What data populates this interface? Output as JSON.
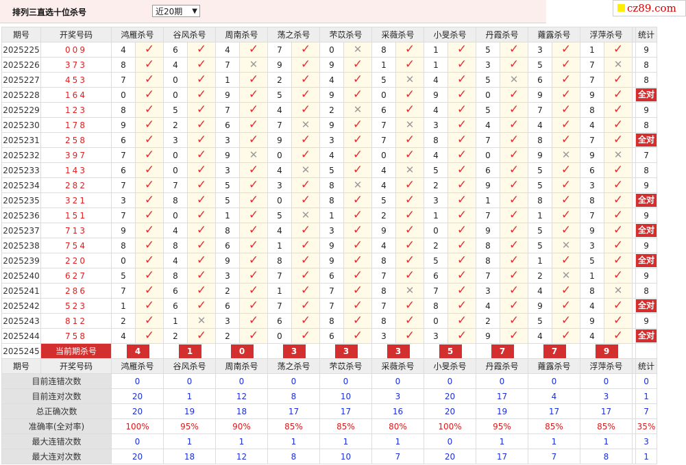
{
  "header": {
    "title": "排列三直选十位杀号",
    "period_select": "近20期"
  },
  "logo": {
    "text": "cz89.com"
  },
  "columns": {
    "period": "期号",
    "winning": "开奖号码",
    "total": "统计"
  },
  "experts": [
    "鸿雁杀号",
    "谷风杀号",
    "周南杀号",
    "荡之杀号",
    "芣苡杀号",
    "采薇杀号",
    "小旻杀号",
    "丹霞杀号",
    "蕹露杀号",
    "浮萍杀号"
  ],
  "rows": [
    {
      "period": "2025225",
      "win": "009",
      "k": [
        "4",
        "6",
        "4",
        "7",
        "0",
        "8",
        "1",
        "5",
        "3",
        "1"
      ],
      "r": [
        1,
        1,
        1,
        1,
        0,
        1,
        1,
        1,
        1,
        1
      ],
      "total": "9"
    },
    {
      "period": "2025226",
      "win": "373",
      "k": [
        "8",
        "4",
        "7",
        "9",
        "9",
        "1",
        "1",
        "3",
        "5",
        "7"
      ],
      "r": [
        1,
        1,
        0,
        1,
        1,
        1,
        1,
        1,
        1,
        0
      ],
      "total": "8"
    },
    {
      "period": "2025227",
      "win": "453",
      "k": [
        "7",
        "0",
        "1",
        "2",
        "4",
        "5",
        "4",
        "5",
        "6",
        "7"
      ],
      "r": [
        1,
        1,
        1,
        1,
        1,
        0,
        1,
        0,
        1,
        1
      ],
      "total": "8"
    },
    {
      "period": "2025228",
      "win": "164",
      "k": [
        "0",
        "0",
        "9",
        "5",
        "9",
        "0",
        "9",
        "0",
        "9",
        "9"
      ],
      "r": [
        1,
        1,
        1,
        1,
        1,
        1,
        1,
        1,
        1,
        1
      ],
      "total": "全对"
    },
    {
      "period": "2025229",
      "win": "123",
      "k": [
        "8",
        "5",
        "7",
        "4",
        "2",
        "6",
        "4",
        "5",
        "7",
        "8"
      ],
      "r": [
        1,
        1,
        1,
        1,
        0,
        1,
        1,
        1,
        1,
        1
      ],
      "total": "9"
    },
    {
      "period": "2025230",
      "win": "178",
      "k": [
        "9",
        "2",
        "6",
        "7",
        "9",
        "7",
        "3",
        "4",
        "4",
        "4"
      ],
      "r": [
        1,
        1,
        1,
        0,
        1,
        0,
        1,
        1,
        1,
        1
      ],
      "total": "8"
    },
    {
      "period": "2025231",
      "win": "258",
      "k": [
        "6",
        "3",
        "3",
        "9",
        "3",
        "7",
        "8",
        "7",
        "8",
        "7"
      ],
      "r": [
        1,
        1,
        1,
        1,
        1,
        1,
        1,
        1,
        1,
        1
      ],
      "total": "全对"
    },
    {
      "period": "2025232",
      "win": "397",
      "k": [
        "7",
        "0",
        "9",
        "0",
        "4",
        "0",
        "4",
        "0",
        "9",
        "9"
      ],
      "r": [
        1,
        1,
        0,
        1,
        1,
        1,
        1,
        1,
        0,
        0
      ],
      "total": "7"
    },
    {
      "period": "2025233",
      "win": "143",
      "k": [
        "6",
        "0",
        "3",
        "4",
        "5",
        "4",
        "5",
        "6",
        "5",
        "6"
      ],
      "r": [
        1,
        1,
        1,
        0,
        1,
        0,
        1,
        1,
        1,
        1
      ],
      "total": "8"
    },
    {
      "period": "2025234",
      "win": "282",
      "k": [
        "7",
        "7",
        "5",
        "3",
        "8",
        "4",
        "2",
        "9",
        "5",
        "3"
      ],
      "r": [
        1,
        1,
        1,
        1,
        0,
        1,
        1,
        1,
        1,
        1
      ],
      "total": "9"
    },
    {
      "period": "2025235",
      "win": "321",
      "k": [
        "3",
        "8",
        "5",
        "0",
        "8",
        "5",
        "3",
        "1",
        "8",
        "8"
      ],
      "r": [
        1,
        1,
        1,
        1,
        1,
        1,
        1,
        1,
        1,
        1
      ],
      "total": "全对"
    },
    {
      "period": "2025236",
      "win": "151",
      "k": [
        "7",
        "0",
        "1",
        "5",
        "1",
        "2",
        "1",
        "7",
        "1",
        "7"
      ],
      "r": [
        1,
        1,
        1,
        0,
        1,
        1,
        1,
        1,
        1,
        1
      ],
      "total": "9"
    },
    {
      "period": "2025237",
      "win": "713",
      "k": [
        "9",
        "4",
        "8",
        "4",
        "3",
        "9",
        "0",
        "9",
        "5",
        "9"
      ],
      "r": [
        1,
        1,
        1,
        1,
        1,
        1,
        1,
        1,
        1,
        1
      ],
      "total": "全对"
    },
    {
      "period": "2025238",
      "win": "754",
      "k": [
        "8",
        "8",
        "6",
        "1",
        "9",
        "4",
        "2",
        "8",
        "5",
        "3"
      ],
      "r": [
        1,
        1,
        1,
        1,
        1,
        1,
        1,
        1,
        0,
        1
      ],
      "total": "9"
    },
    {
      "period": "2025239",
      "win": "220",
      "k": [
        "0",
        "4",
        "9",
        "8",
        "9",
        "8",
        "5",
        "8",
        "1",
        "5"
      ],
      "r": [
        1,
        1,
        1,
        1,
        1,
        1,
        1,
        1,
        1,
        1
      ],
      "total": "全对"
    },
    {
      "period": "2025240",
      "win": "627",
      "k": [
        "5",
        "8",
        "3",
        "7",
        "6",
        "7",
        "6",
        "7",
        "2",
        "1"
      ],
      "r": [
        1,
        1,
        1,
        1,
        1,
        1,
        1,
        1,
        0,
        1
      ],
      "total": "9"
    },
    {
      "period": "2025241",
      "win": "286",
      "k": [
        "7",
        "6",
        "2",
        "1",
        "7",
        "8",
        "7",
        "3",
        "4",
        "8"
      ],
      "r": [
        1,
        1,
        1,
        1,
        1,
        0,
        1,
        1,
        1,
        0
      ],
      "total": "8"
    },
    {
      "period": "2025242",
      "win": "523",
      "k": [
        "1",
        "6",
        "6",
        "7",
        "7",
        "7",
        "8",
        "4",
        "9",
        "4"
      ],
      "r": [
        1,
        1,
        1,
        1,
        1,
        1,
        1,
        1,
        1,
        1
      ],
      "total": "全对"
    },
    {
      "period": "2025243",
      "win": "812",
      "k": [
        "2",
        "1",
        "3",
        "6",
        "8",
        "8",
        "0",
        "2",
        "5",
        "9"
      ],
      "r": [
        1,
        0,
        1,
        1,
        1,
        1,
        1,
        1,
        1,
        1
      ],
      "total": "9"
    },
    {
      "period": "2025244",
      "win": "758",
      "k": [
        "4",
        "2",
        "2",
        "0",
        "6",
        "3",
        "3",
        "9",
        "4",
        "4"
      ],
      "r": [
        1,
        1,
        1,
        1,
        1,
        1,
        1,
        1,
        1,
        1
      ],
      "total": "全对"
    }
  ],
  "current": {
    "period": "2025245",
    "label": "当前期杀号",
    "values": [
      "4",
      "1",
      "0",
      "3",
      "3",
      "3",
      "5",
      "7",
      "7",
      "9"
    ]
  },
  "stats": [
    {
      "label": "目前连错次数",
      "values": [
        "0",
        "0",
        "0",
        "0",
        "0",
        "0",
        "0",
        "0",
        "0",
        "0"
      ],
      "total": "0"
    },
    {
      "label": "目前连对次数",
      "values": [
        "20",
        "1",
        "12",
        "8",
        "10",
        "3",
        "20",
        "17",
        "4",
        "3"
      ],
      "total": "1"
    },
    {
      "label": "总正确次数",
      "values": [
        "20",
        "19",
        "18",
        "17",
        "17",
        "16",
        "20",
        "19",
        "17",
        "17"
      ],
      "total": "7"
    },
    {
      "label": "准确率(全对率)",
      "values": [
        "100%",
        "95%",
        "90%",
        "85%",
        "85%",
        "80%",
        "100%",
        "95%",
        "85%",
        "85%"
      ],
      "total": "35%"
    },
    {
      "label": "最大连错次数",
      "values": [
        "0",
        "1",
        "1",
        "1",
        "1",
        "1",
        "0",
        "1",
        "1",
        "1"
      ],
      "total": "3"
    },
    {
      "label": "最大连对次数",
      "values": [
        "20",
        "18",
        "12",
        "8",
        "10",
        "7",
        "20",
        "17",
        "7",
        "8"
      ],
      "total": "1"
    }
  ],
  "symbols": {
    "right": "✓",
    "wrong": "✕"
  },
  "colors": {
    "accent": "#d32f2f",
    "stat_value": "#1a2fd6",
    "header_bg": "#eeeeee",
    "mark_bg": "#fffbe8"
  }
}
